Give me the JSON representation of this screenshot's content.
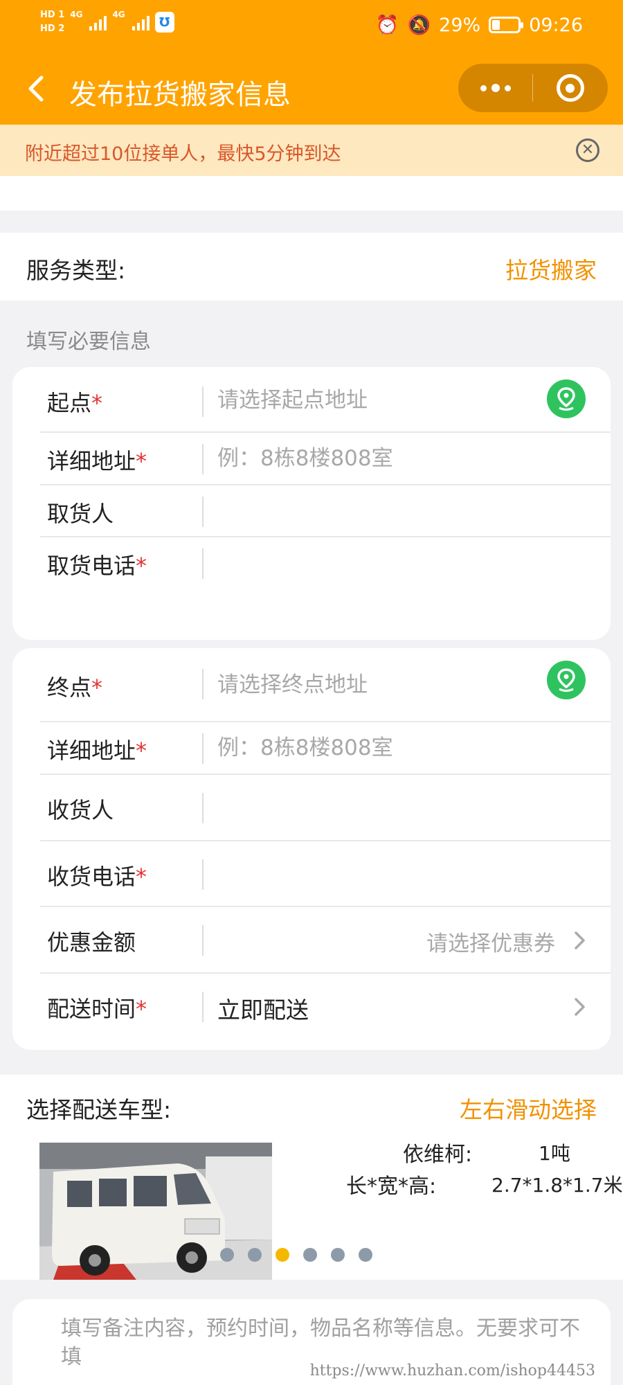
{
  "status": {
    "hd1": "HD 1",
    "hd2": "HD 2",
    "net1": "4G",
    "net2": "4G",
    "battery": "29%",
    "time": "09:26"
  },
  "nav": {
    "title": "发布拉货搬家信息"
  },
  "notice": {
    "text": "附近超过10位接单人，最快5分钟到达"
  },
  "service": {
    "label": "服务类型:",
    "value": "拉货搬家"
  },
  "section_hint": "填写必要信息",
  "start": {
    "origin_label": "起点",
    "origin_placeholder": "请选择起点地址",
    "detail_label": "详细地址",
    "detail_placeholder": "例：8栋8楼808室",
    "sender_label": "取货人",
    "sender_value": "",
    "phone_label": "取货电话",
    "phone_value": ""
  },
  "end": {
    "dest_label": "终点",
    "dest_placeholder": "请选择终点地址",
    "detail_label": "详细地址",
    "detail_placeholder": "例：8栋8楼808室",
    "receiver_label": "收货人",
    "receiver_value": "",
    "phone_label": "收货电话",
    "phone_value": "",
    "discount_label": "优惠金额",
    "discount_placeholder": "请选择优惠券",
    "time_label": "配送时间",
    "time_value": "立即配送"
  },
  "required_mark": "*",
  "vehicle": {
    "label": "选择配送车型:",
    "hint": "左右滑动选择",
    "name_label": "依维柯:",
    "tonnage": "1吨",
    "size_label": "长*宽*高:",
    "size_value": "2.7*1.8*1.7米",
    "dot_count": 6,
    "active_dot": 2
  },
  "remark": {
    "placeholder": "填写备注内容，预约时间，物品名称等信息。无要求可不填"
  },
  "watermark": "https://www.huzhan.com/ishop44453",
  "colors": {
    "brand": "#ffa300",
    "accent": "#f29100",
    "required": "#e33434",
    "location": "#2fc35f"
  }
}
